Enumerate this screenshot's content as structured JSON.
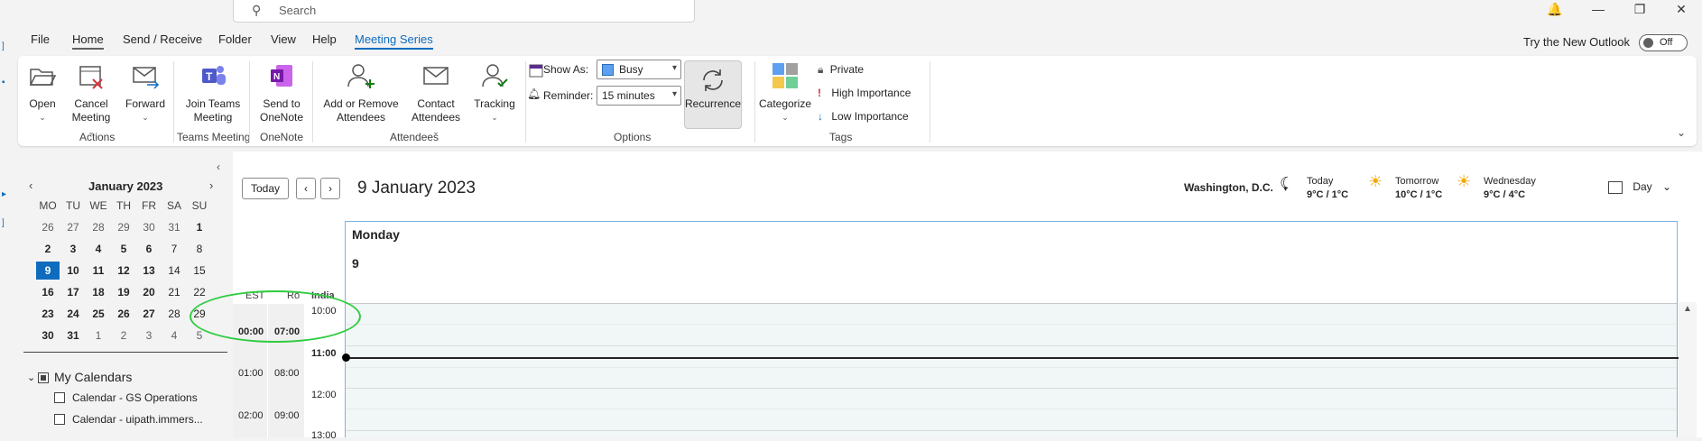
{
  "search": {
    "placeholder": "Search"
  },
  "window": {
    "bell": "🔔",
    "min": "—",
    "restore": "❐",
    "close": "✕"
  },
  "menu": {
    "tabs": [
      "File",
      "Home",
      "Send / Receive",
      "Folder",
      "View",
      "Help",
      "Meeting Series"
    ],
    "try_new": "Try the New Outlook",
    "toggle": "Off"
  },
  "ribbon": {
    "actions": {
      "open": "Open",
      "cancel": "Cancel",
      "cancel2": "Meeting",
      "forward": "Forward",
      "group": "Actions"
    },
    "teams": {
      "l1": "Join Teams",
      "l2": "Meeting",
      "group": "Teams Meeting"
    },
    "onenote": {
      "l1": "Send to",
      "l2": "OneNote",
      "group": "OneNote"
    },
    "attendees": {
      "add1": "Add or Remove",
      "add2": "Attendees",
      "contact1": "Contact",
      "contact2": "Attendees",
      "tracking": "Tracking",
      "group": "Attendees"
    },
    "options": {
      "show_as_label": "Show As:",
      "show_as_value": "Busy",
      "reminder_label": "Reminder:",
      "reminder_value": "15 minutes",
      "recurrence": "Recurrence",
      "group": "Options"
    },
    "tags": {
      "categorize": "Categorize",
      "private": "Private",
      "high": "High Importance",
      "low": "Low Importance",
      "group": "Tags"
    }
  },
  "minical": {
    "title": "January 2023",
    "dow": [
      "MO",
      "TU",
      "WE",
      "TH",
      "FR",
      "SA",
      "SU"
    ],
    "weeks": [
      [
        "26",
        "27",
        "28",
        "29",
        "30",
        "31",
        "1"
      ],
      [
        "2",
        "3",
        "4",
        "5",
        "6",
        "7",
        "8"
      ],
      [
        "9",
        "10",
        "11",
        "12",
        "13",
        "14",
        "15"
      ],
      [
        "16",
        "17",
        "18",
        "19",
        "20",
        "21",
        "22"
      ],
      [
        "23",
        "24",
        "25",
        "26",
        "27",
        "28",
        "29"
      ],
      [
        "30",
        "31",
        "1",
        "2",
        "3",
        "4",
        "5"
      ]
    ]
  },
  "calendars": {
    "header": "My Calendars",
    "items": [
      "Calendar - GS Operations",
      "Calendar - uipath.immers..."
    ]
  },
  "main": {
    "today": "Today",
    "date_title": "9 January 2023",
    "location": "Washington, D.C.",
    "weather": [
      {
        "day": "Today",
        "temp": "9°C / 1°C"
      },
      {
        "day": "Tomorrow",
        "temp": "10°C / 1°C"
      },
      {
        "day": "Wednesday",
        "temp": "9°C / 4°C"
      }
    ],
    "view": "Day",
    "day_name": "Monday",
    "day_num": "9",
    "tz_labels": [
      "EST",
      "Ro",
      "India"
    ],
    "est_times": [
      "00:00",
      "01:00",
      "02:00"
    ],
    "ro_times": [
      "07:00",
      "08:00",
      "09:00"
    ],
    "india_times": [
      "10:00",
      "11:00",
      "12:00",
      "13:00"
    ]
  }
}
